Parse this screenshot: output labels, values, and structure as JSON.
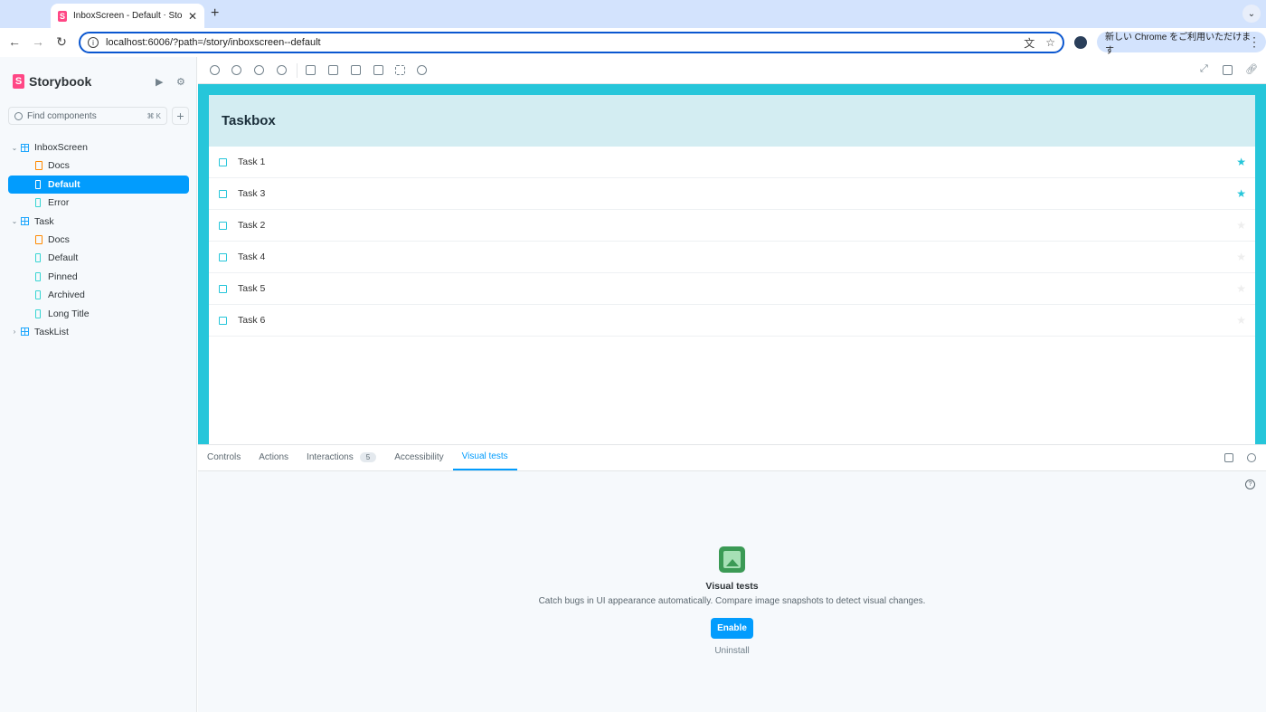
{
  "browser": {
    "tab_title": "InboxScreen - Default ⋅ Story",
    "tab_close": "✕",
    "new_tab": "+",
    "url": "localhost:6006/?path=/story/inboxscreen--default",
    "promo": "新しい Chrome をご利用いただけます",
    "back_glyph": "←",
    "forward_glyph": "→",
    "reload_glyph": "↻",
    "star_glyph": "☆",
    "translate_glyph": "文",
    "kebab_glyph": "⋮",
    "menu_glyph": "⌄"
  },
  "sidebar": {
    "brand": "Storybook",
    "search_placeholder": "Find components",
    "search_shortcut": "⌘ K",
    "add_glyph": "+",
    "tree": [
      {
        "type": "component",
        "label": "InboxScreen",
        "expanded": true
      },
      {
        "type": "docs",
        "label": "Docs"
      },
      {
        "type": "story",
        "label": "Default",
        "active": true
      },
      {
        "type": "story",
        "label": "Error"
      },
      {
        "type": "component",
        "label": "Task",
        "expanded": true
      },
      {
        "type": "docs",
        "label": "Docs"
      },
      {
        "type": "story",
        "label": "Default"
      },
      {
        "type": "story",
        "label": "Pinned"
      },
      {
        "type": "story",
        "label": "Archived"
      },
      {
        "type": "story",
        "label": "Long Title"
      },
      {
        "type": "component",
        "label": "TaskList",
        "expanded": false
      }
    ]
  },
  "preview": {
    "title": "Taskbox",
    "tasks": [
      {
        "title": "Task 1",
        "pinned": true
      },
      {
        "title": "Task 3",
        "pinned": true
      },
      {
        "title": "Task 2",
        "pinned": false
      },
      {
        "title": "Task 4",
        "pinned": false
      },
      {
        "title": "Task 5",
        "pinned": false
      },
      {
        "title": "Task 6",
        "pinned": false
      }
    ]
  },
  "panel": {
    "tabs": [
      {
        "label": "Controls"
      },
      {
        "label": "Actions"
      },
      {
        "label": "Interactions",
        "count": "5"
      },
      {
        "label": "Accessibility"
      },
      {
        "label": "Visual tests",
        "active": true
      }
    ],
    "help_glyph": "?",
    "visual_tests": {
      "title": "Visual tests",
      "description": "Catch bugs in UI appearance automatically. Compare image snapshots to detect visual changes.",
      "enable_label": "Enable",
      "uninstall_label": "Uninstall"
    }
  },
  "colors": {
    "storybook_pink": "#ff4785",
    "accent_blue": "#029cfd",
    "teal": "#26c6da"
  }
}
